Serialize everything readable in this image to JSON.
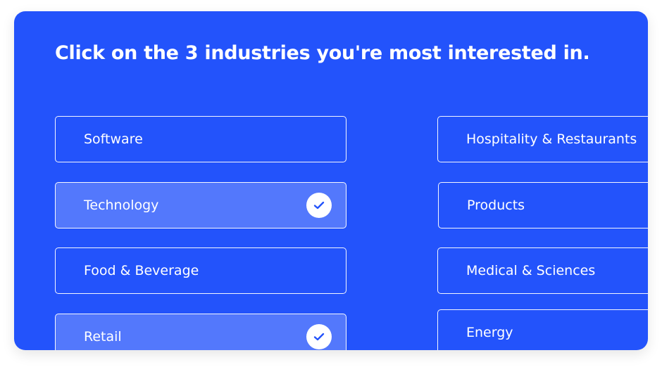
{
  "colors": {
    "accent": "#2353fb",
    "check": "#2353fb"
  },
  "heading": "Click on the 3 industries you're most interested in.",
  "options": [
    {
      "label": "Software",
      "selected": false,
      "icon": "checkmark-icon"
    },
    {
      "label": "Technology",
      "selected": true,
      "icon": "checkmark-icon"
    },
    {
      "label": "Food & Beverage",
      "selected": false,
      "icon": "checkmark-icon"
    },
    {
      "label": "Retail",
      "selected": true,
      "icon": "checkmark-icon"
    },
    {
      "label": "Hospitality & Restaurants",
      "selected": false,
      "icon": "checkmark-icon"
    },
    {
      "label": "Products",
      "selected": false,
      "icon": "checkmark-icon"
    },
    {
      "label": "Medical & Sciences",
      "selected": false,
      "icon": "checkmark-icon"
    },
    {
      "label": "Energy",
      "selected": false,
      "icon": "checkmark-icon"
    }
  ]
}
